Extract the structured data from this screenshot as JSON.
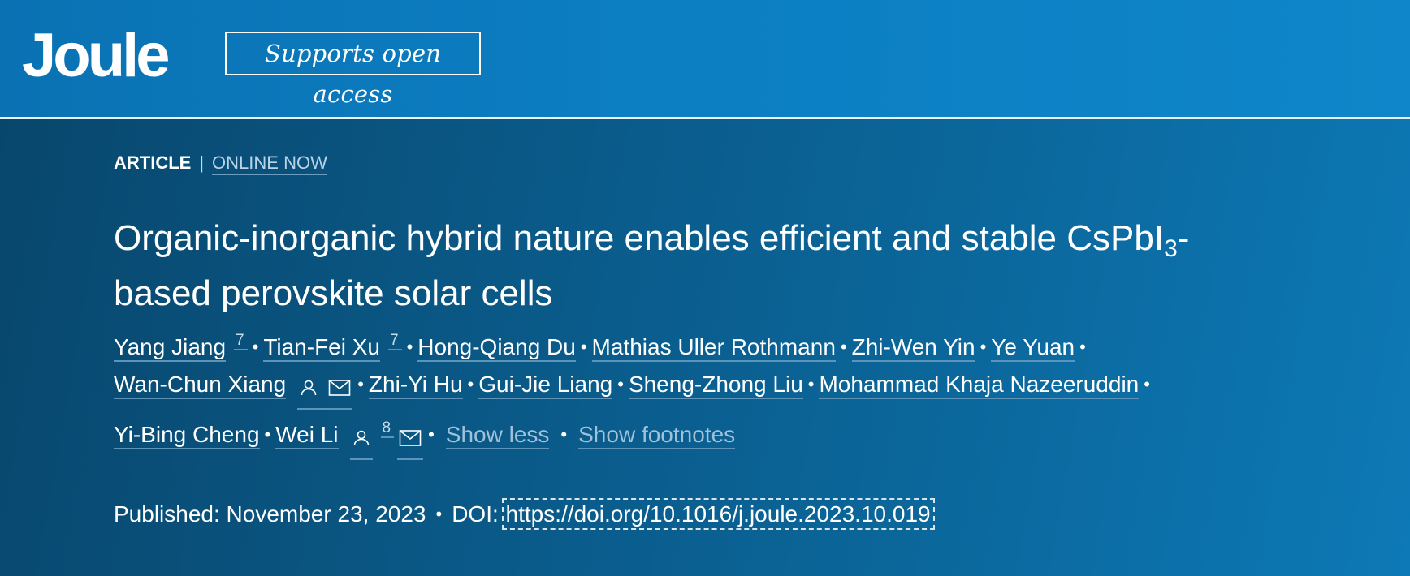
{
  "header": {
    "journal_logo": "Joule",
    "open_access_badge": "Supports open access"
  },
  "article": {
    "type": "ARTICLE",
    "separator": "|",
    "status_link": "ONLINE NOW",
    "title_main": "Organic-inorganic hybrid nature enables efficient and stable CsPbI",
    "title_sub": "3",
    "title_rest_line1": "-",
    "title_line2": "based perovskite solar cells"
  },
  "authors": {
    "rows": [
      [
        "Yang Jiang",
        "Tian-Fei Xu",
        "Hong-Qiang Du",
        "Mathias Uller Rothmann",
        "Zhi-Wen Yin",
        "Ye Yuan"
      ],
      [
        "Wan-Chun Xiang",
        "Zhi-Yi Hu",
        "Gui-Jie Liang",
        "Sheng-Zhong Liu",
        "Mohammad Khaja Nazeeruddin"
      ],
      [
        "Yi-Bing Cheng",
        "Wei Li"
      ]
    ],
    "footnotes": {
      "yang_jiang": "7",
      "tian_fei_xu": "7",
      "wei_li": "8"
    },
    "show_less": "Show less",
    "show_footnotes": "Show footnotes",
    "bullet": "•"
  },
  "publication": {
    "published_label": "Published:",
    "published_date": "November 23, 2023",
    "doi_label": "DOI:",
    "doi_url": "https://doi.org/10.1016/j.joule.2023.10.019"
  },
  "icons": {
    "person": "person-icon",
    "envelope": "envelope-icon"
  }
}
